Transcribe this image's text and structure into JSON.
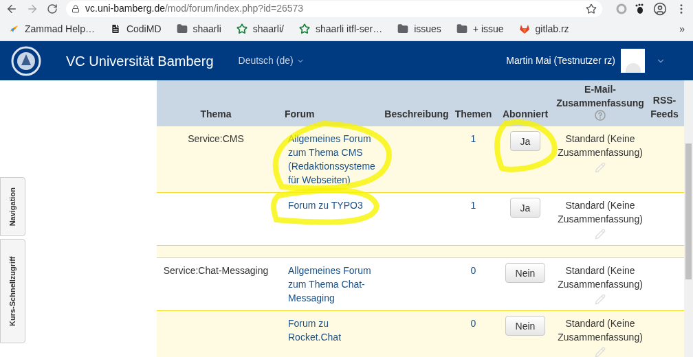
{
  "browser": {
    "url_host": "vc.uni-bamberg.de",
    "url_path": "/mod/forum/index.php?id=26573",
    "bookmarks": [
      {
        "kind": "zammad",
        "label": "Zammad Help…"
      },
      {
        "kind": "doc",
        "label": "CodiMD"
      },
      {
        "kind": "folder",
        "label": "shaarli"
      },
      {
        "kind": "star",
        "label": "shaarli/"
      },
      {
        "kind": "star",
        "label": "shaarli itfl-ser…"
      },
      {
        "kind": "folder",
        "label": "issues"
      },
      {
        "kind": "folder",
        "label": "+ issue"
      },
      {
        "kind": "gitlab",
        "label": "gitlab.rz"
      }
    ],
    "more": "»"
  },
  "navbar": {
    "title": "VC Universität Bamberg",
    "language": "Deutsch (de)",
    "user": "Martin Mai (Testnutzer rz)"
  },
  "side_tabs": [
    "Navigation",
    "Kurs-Schnellzugriff"
  ],
  "table": {
    "columns": [
      "Thema",
      "Forum",
      "Beschreibung",
      "Themen",
      "Abonniert",
      "E-Mail-Zusammenfassung",
      "RSS-Feeds"
    ],
    "rows": [
      {
        "kind": "forum",
        "thema": "Service:CMS",
        "forum": "Allgemeines Forum zum Thema CMS (Redaktionssysteme für Webseiten)",
        "themen": "1",
        "abonniert": "Ja",
        "email": "Standard (Keine Zusammenfassung)"
      },
      {
        "kind": "forum",
        "forum": "Forum zu TYPO3",
        "themen": "1",
        "abonniert": "Ja",
        "email": "Standard (Keine Zusammenfassung)"
      },
      {
        "kind": "spacer"
      },
      {
        "kind": "forum",
        "thema": "Service:Chat-Messaging",
        "forum": "Allgemeines Forum zum Thema Chat-Messaging",
        "themen": "0",
        "abonniert": "Nein",
        "email": "Standard (Keine Zusammenfassung)"
      },
      {
        "kind": "forum",
        "forum": "Forum zu Rocket.Chat",
        "themen": "0",
        "abonniert": "Nein",
        "email": "Standard (Keine Zusammenfassung)"
      }
    ]
  }
}
